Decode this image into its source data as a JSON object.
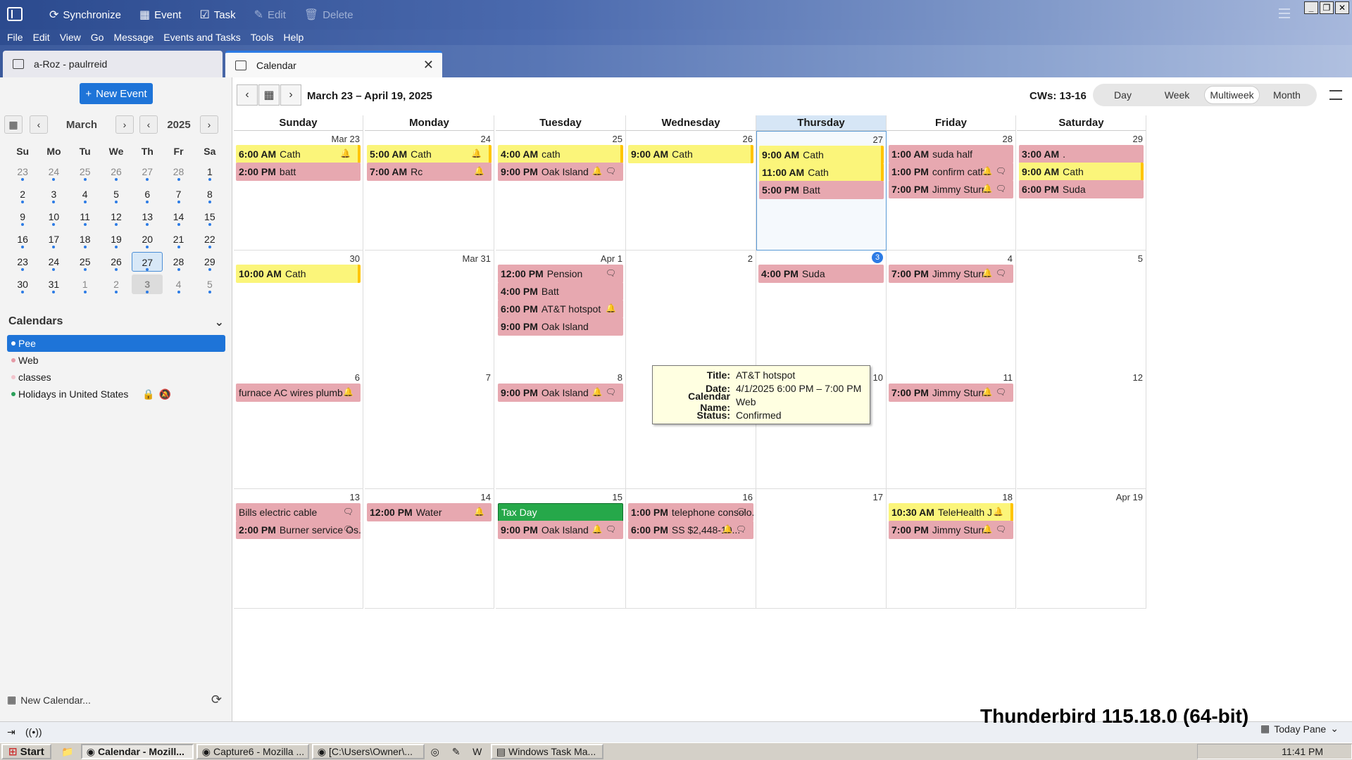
{
  "toolbar": {
    "synchronize": "Synchronize",
    "event": "Event",
    "task": "Task",
    "edit": "Edit",
    "delete": "Delete"
  },
  "menu": [
    "File",
    "Edit",
    "View",
    "Go",
    "Message",
    "Events and Tasks",
    "Tools",
    "Help"
  ],
  "tabs": {
    "mail": "a-Roz - paulrreid",
    "calendar": "Calendar"
  },
  "left": {
    "new_event": "New Event",
    "month": "March",
    "year": "2025",
    "weekdays": [
      "Su",
      "Mo",
      "Tu",
      "We",
      "Th",
      "Fr",
      "Sa"
    ],
    "weeks": [
      [
        "23",
        "24",
        "25",
        "26",
        "27",
        "28",
        "1"
      ],
      [
        "2",
        "3",
        "4",
        "5",
        "6",
        "7",
        "8"
      ],
      [
        "9",
        "10",
        "11",
        "12",
        "13",
        "14",
        "15"
      ],
      [
        "16",
        "17",
        "18",
        "19",
        "20",
        "21",
        "22"
      ],
      [
        "23",
        "24",
        "25",
        "26",
        "27",
        "28",
        "29"
      ],
      [
        "30",
        "31",
        "1",
        "2",
        "3",
        "4",
        "5"
      ]
    ],
    "calendars_title": "Calendars",
    "calendars": [
      {
        "name": "Pee",
        "color": "#ffffff"
      },
      {
        "name": "Web",
        "color": "#e59aa6"
      },
      {
        "name": "classes",
        "color": "#f2c4cc"
      },
      {
        "name": "Holidays in United States",
        "color": "#2aa05a"
      }
    ],
    "new_calendar": "New Calendar..."
  },
  "main": {
    "range": "March 23 – April 19, 2025",
    "cws": "CWs: 13-16",
    "views": [
      "Day",
      "Week",
      "Multiweek",
      "Month"
    ],
    "active_view": "Multiweek",
    "day_names": [
      "Sunday",
      "Monday",
      "Tuesday",
      "Wednesday",
      "Thursday",
      "Friday",
      "Saturday"
    ],
    "weeks": [
      {
        "days": [
          {
            "num": "Mar 23",
            "events": [
              {
                "t": "6:00 AM",
                "n": "Cath",
                "c": "y",
                "i": "🔔"
              },
              {
                "t": "2:00 PM",
                "n": "batt",
                "c": "p",
                "i": ""
              }
            ]
          },
          {
            "num": "24",
            "events": [
              {
                "t": "5:00 AM",
                "n": "Cath",
                "c": "y",
                "i": "🔔"
              },
              {
                "t": "7:00 AM",
                "n": "Rc",
                "c": "p",
                "i": "🔔"
              }
            ]
          },
          {
            "num": "25",
            "events": [
              {
                "t": "4:00 AM",
                "n": "cath",
                "c": "y",
                "i": ""
              },
              {
                "t": "9:00 PM",
                "n": "Oak Island",
                "c": "p",
                "i": "🔔🗨"
              }
            ]
          },
          {
            "num": "26",
            "events": [
              {
                "t": "9:00 AM",
                "n": "Cath",
                "c": "y",
                "i": ""
              }
            ]
          },
          {
            "num": "27",
            "events": [
              {
                "t": "9:00 AM",
                "n": "Cath",
                "c": "y",
                "i": ""
              },
              {
                "t": "11:00 AM",
                "n": "Cath",
                "c": "y",
                "i": ""
              },
              {
                "t": "5:00 PM",
                "n": "Batt",
                "c": "p",
                "i": ""
              }
            ]
          },
          {
            "num": "28",
            "events": [
              {
                "t": "1:00 AM",
                "n": "suda half",
                "c": "p",
                "i": ""
              },
              {
                "t": "1:00 PM",
                "n": "confirm cath",
                "c": "p",
                "i": "🔔🗨"
              },
              {
                "t": "7:00 PM",
                "n": "Jimmy Sturr",
                "c": "p",
                "i": "🔔🗨"
              }
            ]
          },
          {
            "num": "29",
            "events": [
              {
                "t": "3:00 AM",
                "n": ".",
                "c": "p",
                "i": ""
              },
              {
                "t": "9:00 AM",
                "n": "Cath",
                "c": "y",
                "i": ""
              },
              {
                "t": "6:00 PM",
                "n": "Suda",
                "c": "p",
                "i": ""
              }
            ]
          }
        ]
      },
      {
        "days": [
          {
            "num": "30",
            "events": [
              {
                "t": "10:00 AM",
                "n": "Cath",
                "c": "y",
                "i": ""
              }
            ]
          },
          {
            "num": "Mar 31",
            "events": []
          },
          {
            "num": "Apr 1",
            "events": [
              {
                "t": "12:00 PM",
                "n": "Pension",
                "c": "p",
                "i": "🗨"
              },
              {
                "t": "4:00 PM",
                "n": "Batt",
                "c": "p",
                "i": ""
              },
              {
                "t": "6:00 PM",
                "n": "AT&T hotspot",
                "c": "p",
                "i": "🔔"
              },
              {
                "t": "9:00 PM",
                "n": "Oak Island",
                "c": "p",
                "i": ""
              }
            ]
          },
          {
            "num": "2",
            "events": []
          },
          {
            "num": "3",
            "events": [
              {
                "t": "4:00 PM",
                "n": "Suda",
                "c": "p",
                "i": ""
              }
            ]
          },
          {
            "num": "4",
            "events": [
              {
                "t": "7:00 PM",
                "n": "Jimmy Sturr",
                "c": "p",
                "i": "🔔🗨"
              }
            ]
          },
          {
            "num": "5",
            "events": []
          }
        ]
      },
      {
        "days": [
          {
            "num": "6",
            "events": [
              {
                "t": "",
                "n": "furnace AC wires plumb",
                "c": "p",
                "i": "🔔"
              }
            ]
          },
          {
            "num": "7",
            "events": []
          },
          {
            "num": "8",
            "events": [
              {
                "t": "9:00 PM",
                "n": "Oak Island",
                "c": "p",
                "i": "🔔🗨"
              }
            ]
          },
          {
            "num": "9",
            "events": []
          },
          {
            "num": "10",
            "events": []
          },
          {
            "num": "11",
            "events": [
              {
                "t": "7:00 PM",
                "n": "Jimmy Sturr",
                "c": "p",
                "i": "🔔🗨"
              }
            ]
          },
          {
            "num": "12",
            "events": []
          }
        ]
      },
      {
        "days": [
          {
            "num": "13",
            "events": [
              {
                "t": "",
                "n": "Bills electric cable",
                "c": "p",
                "i": "🗨"
              },
              {
                "t": "2:00 PM",
                "n": "Burner service Os...",
                "c": "p",
                "i": "🗨"
              }
            ]
          },
          {
            "num": "14",
            "events": [
              {
                "t": "12:00 PM",
                "n": "Water",
                "c": "p",
                "i": "🔔"
              }
            ]
          },
          {
            "num": "15",
            "events": [
              {
                "t": "",
                "n": "Tax Day",
                "c": "g",
                "i": ""
              },
              {
                "t": "9:00 PM",
                "n": "Oak Island",
                "c": "p",
                "i": "🔔🗨"
              }
            ]
          },
          {
            "num": "16",
            "events": [
              {
                "t": "1:00 PM",
                "n": "telephone consolo...",
                "c": "p",
                "i": "🗨"
              },
              {
                "t": "6:00 PM",
                "n": "SS $2,448-10...",
                "c": "p",
                "i": "🔔🗨"
              }
            ]
          },
          {
            "num": "17",
            "events": []
          },
          {
            "num": "18",
            "events": [
              {
                "t": "10:30 AM",
                "n": "TeleHealth J",
                "c": "y",
                "i": "🔔"
              },
              {
                "t": "7:00 PM",
                "n": "Jimmy Sturr",
                "c": "p",
                "i": "🔔🗨"
              }
            ]
          },
          {
            "num": "Apr 19",
            "events": []
          }
        ]
      }
    ]
  },
  "tooltip": {
    "title_label": "Title:",
    "title": "AT&T hotspot",
    "date_label": "Date:",
    "date": "4/1/2025 6:00 PM – 7:00 PM",
    "calname_label": "Calendar Name:",
    "calname": "Web",
    "status_label": "Status:",
    "status": "Confirmed"
  },
  "status": {
    "version": "Thunderbird 115.18.0 (64-bit)",
    "today_pane": "Today Pane"
  },
  "taskbar": {
    "start": "Start",
    "tasks": [
      "Calendar - Mozill...",
      "Capture6 - Mozilla ...",
      "[C:\\Users\\Owner\\...",
      "Windows Task Ma..."
    ],
    "clock": "11:41 PM"
  }
}
